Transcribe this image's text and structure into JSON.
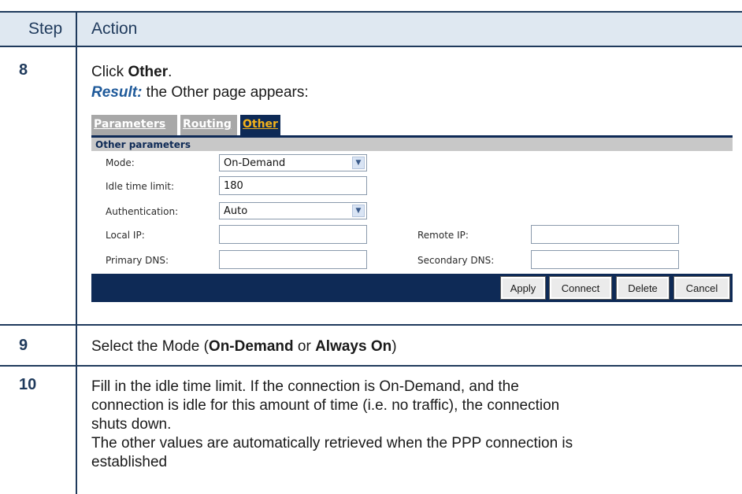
{
  "table": {
    "header": {
      "step": "Step",
      "action": "Action"
    },
    "rows": [
      {
        "step": "8",
        "line1_pre": "Click ",
        "line1_bold": "Other",
        "line1_post": ".",
        "result_label": "Result:",
        "result_text": " the Other page appears:"
      },
      {
        "step": "9",
        "pre": "Select the Mode (",
        "bold1": "On-Demand",
        "mid": " or ",
        "bold2": "Always On",
        "post": ")"
      },
      {
        "step": "10",
        "lines": [
          "Fill in the idle time limit. If the connection is On-Demand, and the",
          "connection is idle for this amount of time (i.e. no traffic), the connection",
          "shuts down.",
          "The other values are automatically retrieved when the PPP connection is",
          "established"
        ]
      }
    ]
  },
  "ui": {
    "tabs": {
      "parameters": "Parameters",
      "routing": "Routing",
      "other": "Other"
    },
    "section_title": "Other parameters",
    "fields": {
      "mode_label": "Mode:",
      "mode_value": "On-Demand",
      "idle_label": "Idle time limit:",
      "idle_value": "180",
      "auth_label": "Authentication:",
      "auth_value": "Auto",
      "local_ip_label": "Local IP:",
      "local_ip_value": "",
      "remote_ip_label": "Remote IP:",
      "remote_ip_value": "",
      "primary_dns_label": "Primary DNS:",
      "primary_dns_value": "",
      "secondary_dns_label": "Secondary DNS:",
      "secondary_dns_value": ""
    },
    "buttons": {
      "apply": "Apply",
      "connect": "Connect",
      "delete": "Delete",
      "cancel": "Cancel"
    },
    "icons": {
      "select_arrow": "chevron-down-icon"
    },
    "colors": {
      "navy": "#0e2a56",
      "active_tab_text": "#f2b21b",
      "inactive_tab": "#a8a8a8"
    }
  }
}
